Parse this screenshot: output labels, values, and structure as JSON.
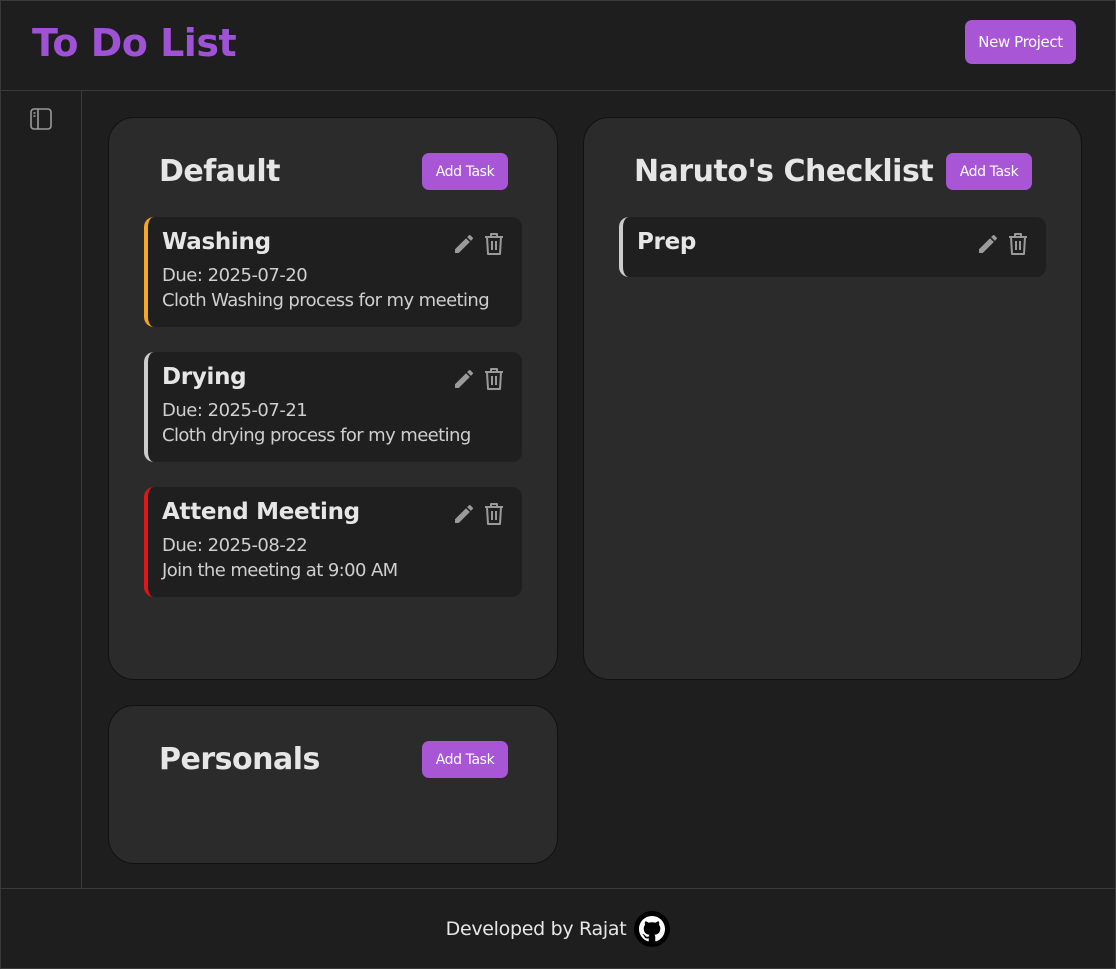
{
  "header": {
    "title": "To Do List",
    "new_project_label": "New Project"
  },
  "accent_color": "#a855d6",
  "projects": [
    {
      "title": "Default",
      "add_task_label": "Add Task",
      "tasks": [
        {
          "title": "Washing",
          "due": "Due: 2025-07-20",
          "description": "Cloth Washing process for my meeting",
          "priority_color": "#f5a623"
        },
        {
          "title": "Drying",
          "due": "Due: 2025-07-21",
          "description": "Cloth drying process for my meeting",
          "priority_color": "#cccccc"
        },
        {
          "title": "Attend Meeting",
          "due": "Due: 2025-08-22",
          "description": "Join the meeting at 9:00 AM",
          "priority_color": "#e01515"
        }
      ]
    },
    {
      "title": "Naruto's Checklist",
      "add_task_label": "Add Task",
      "tasks": [
        {
          "title": "Prep",
          "priority_color": "#cccccc"
        }
      ]
    },
    {
      "title": "Personals",
      "add_task_label": "Add Task",
      "tasks": []
    }
  ],
  "icons": {
    "sidebar_toggle": "sidebar-toggle-icon",
    "edit": "pencil-icon",
    "delete": "trash-icon",
    "github": "github-icon"
  },
  "footer": {
    "text": "Developed by Rajat"
  }
}
